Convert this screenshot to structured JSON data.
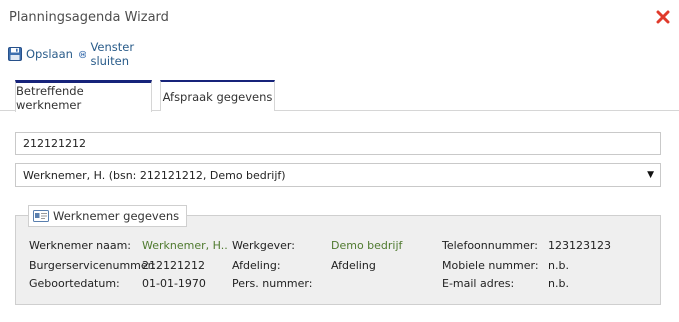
{
  "window": {
    "title": "Planningsagenda Wizard",
    "close_icon": "close-x-icon",
    "accent_close": "#e03a2b"
  },
  "toolbar": {
    "save_label": "Opslaan",
    "close_window_label": "Venster sluiten"
  },
  "tabs": [
    {
      "label": "Betreffende werknemer",
      "active": true
    },
    {
      "label": "Afspraak gegevens",
      "active": false
    }
  ],
  "search": {
    "value": "212121212"
  },
  "employee_select": {
    "selected": "Werknemer, H. (bsn: 212121212, Demo bedrijf)"
  },
  "employee_info": {
    "legend": "Werknemer gegevens",
    "col1": {
      "name_label": "Werknemer naam:",
      "name_value": "Werknemer, H..",
      "bsn_label": "Burgerservicenummer:",
      "bsn_value": "212121212",
      "dob_label": "Geboortedatum:",
      "dob_value": "01-01-1970"
    },
    "col2": {
      "employer_label": "Werkgever:",
      "employer_value": "Demo bedrijf",
      "department_label": "Afdeling:",
      "department_value": "Afdeling",
      "pers_label": "Pers. nummer:",
      "pers_value": ""
    },
    "col3": {
      "phone_label": "Telefoonnummer:",
      "phone_value": "123123123",
      "mobile_label": "Mobiele nummer:",
      "mobile_value": "n.b.",
      "email_label": "E-mail adres:",
      "email_value": "n.b."
    }
  },
  "colors": {
    "tab_accent": "#16237a",
    "link_blue": "#2a5c8a",
    "link_green": "#4f7a2f",
    "panel_bg": "#efefef"
  }
}
